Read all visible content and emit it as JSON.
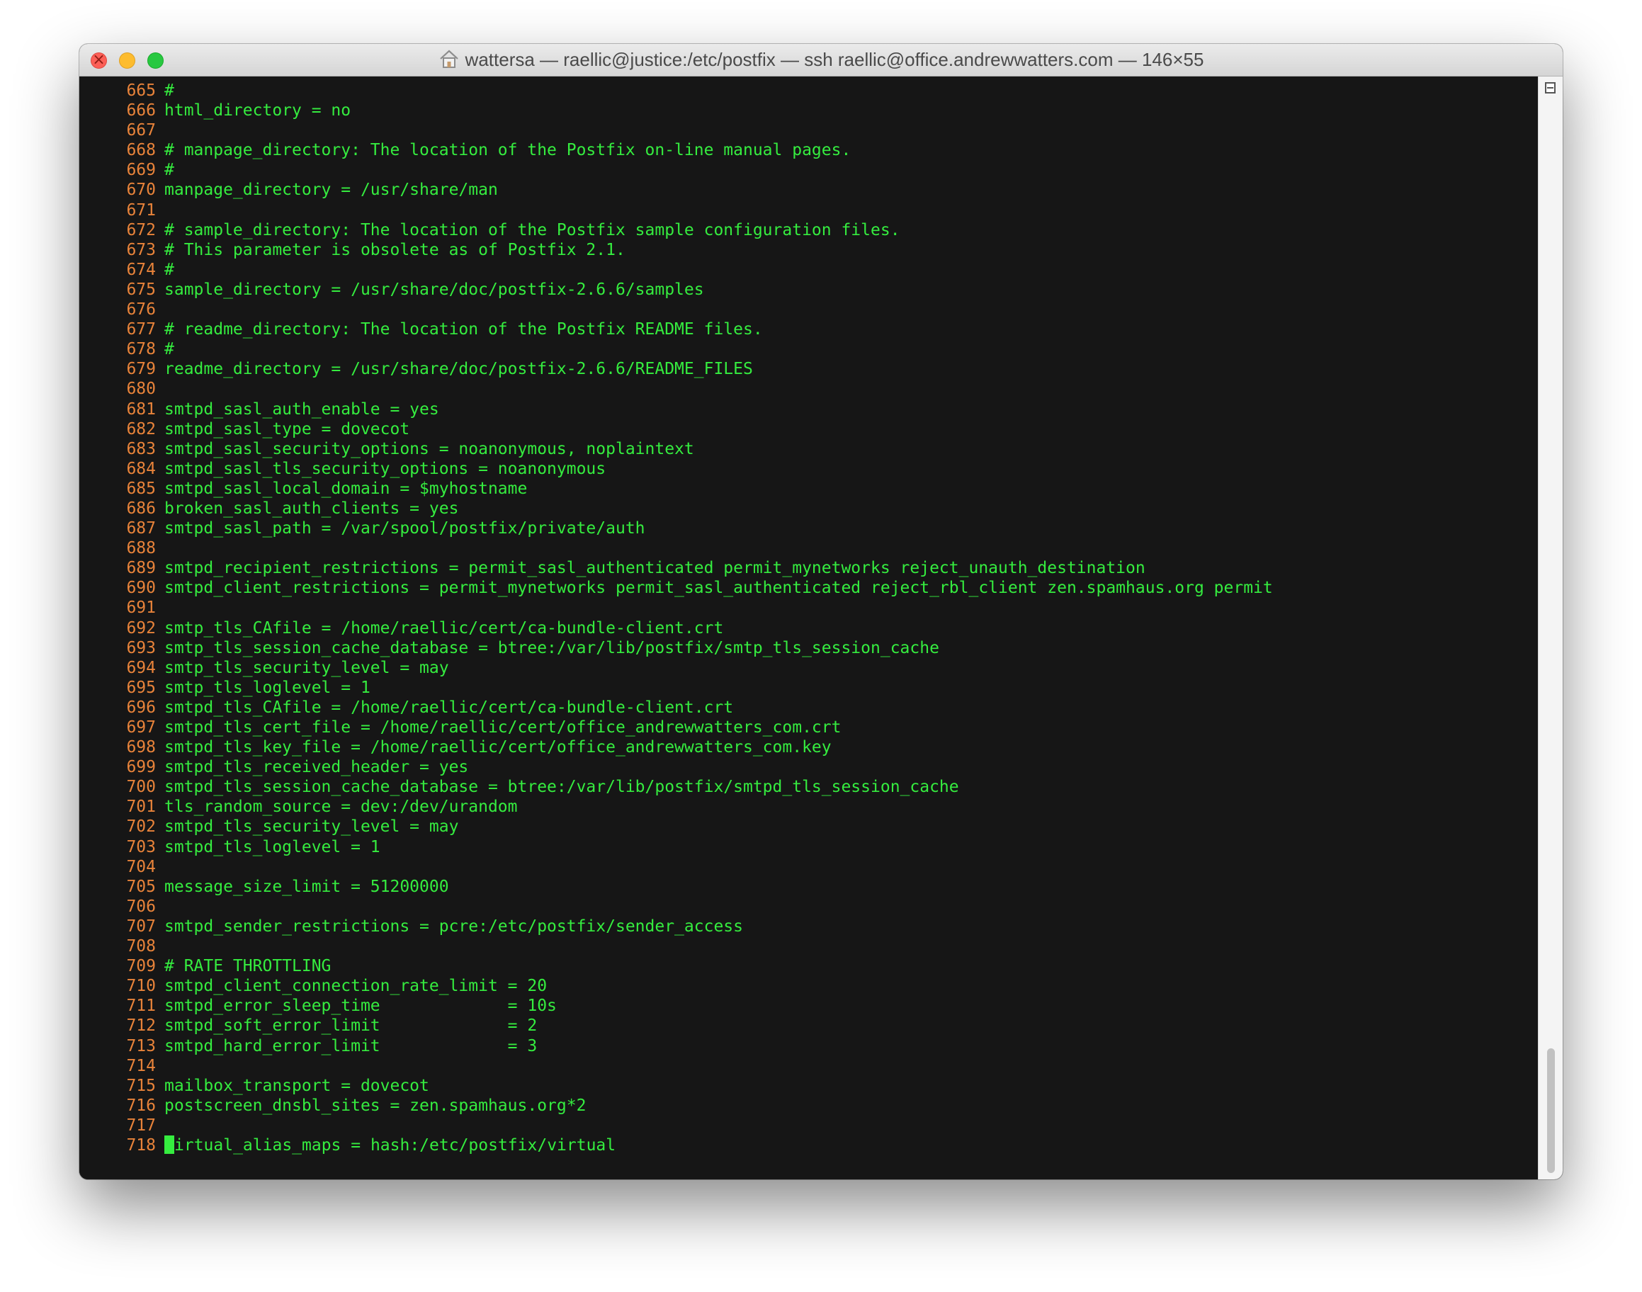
{
  "window": {
    "title": "wattersa — raellic@justice:/etc/postfix — ssh raellic@office.andrewwatters.com — 146×55"
  },
  "terminal": {
    "lines": [
      {
        "num": "665",
        "text": "#"
      },
      {
        "num": "666",
        "text": "html_directory = no"
      },
      {
        "num": "667",
        "text": ""
      },
      {
        "num": "668",
        "text": "# manpage_directory: The location of the Postfix on-line manual pages."
      },
      {
        "num": "669",
        "text": "#"
      },
      {
        "num": "670",
        "text": "manpage_directory = /usr/share/man"
      },
      {
        "num": "671",
        "text": ""
      },
      {
        "num": "672",
        "text": "# sample_directory: The location of the Postfix sample configuration files."
      },
      {
        "num": "673",
        "text": "# This parameter is obsolete as of Postfix 2.1."
      },
      {
        "num": "674",
        "text": "#"
      },
      {
        "num": "675",
        "text": "sample_directory = /usr/share/doc/postfix-2.6.6/samples"
      },
      {
        "num": "676",
        "text": ""
      },
      {
        "num": "677",
        "text": "# readme_directory: The location of the Postfix README files."
      },
      {
        "num": "678",
        "text": "#"
      },
      {
        "num": "679",
        "text": "readme_directory = /usr/share/doc/postfix-2.6.6/README_FILES"
      },
      {
        "num": "680",
        "text": ""
      },
      {
        "num": "681",
        "text": "smtpd_sasl_auth_enable = yes"
      },
      {
        "num": "682",
        "text": "smtpd_sasl_type = dovecot"
      },
      {
        "num": "683",
        "text": "smtpd_sasl_security_options = noanonymous, noplaintext"
      },
      {
        "num": "684",
        "text": "smtpd_sasl_tls_security_options = noanonymous"
      },
      {
        "num": "685",
        "text": "smtpd_sasl_local_domain = $myhostname"
      },
      {
        "num": "686",
        "text": "broken_sasl_auth_clients = yes"
      },
      {
        "num": "687",
        "text": "smtpd_sasl_path = /var/spool/postfix/private/auth"
      },
      {
        "num": "688",
        "text": ""
      },
      {
        "num": "689",
        "text": "smtpd_recipient_restrictions = permit_sasl_authenticated permit_mynetworks reject_unauth_destination"
      },
      {
        "num": "690",
        "text": "smtpd_client_restrictions = permit_mynetworks permit_sasl_authenticated reject_rbl_client zen.spamhaus.org permit"
      },
      {
        "num": "691",
        "text": ""
      },
      {
        "num": "692",
        "text": "smtp_tls_CAfile = /home/raellic/cert/ca-bundle-client.crt"
      },
      {
        "num": "693",
        "text": "smtp_tls_session_cache_database = btree:/var/lib/postfix/smtp_tls_session_cache"
      },
      {
        "num": "694",
        "text": "smtp_tls_security_level = may"
      },
      {
        "num": "695",
        "text": "smtp_tls_loglevel = 1"
      },
      {
        "num": "696",
        "text": "smtpd_tls_CAfile = /home/raellic/cert/ca-bundle-client.crt"
      },
      {
        "num": "697",
        "text": "smtpd_tls_cert_file = /home/raellic/cert/office_andrewwatters_com.crt"
      },
      {
        "num": "698",
        "text": "smtpd_tls_key_file = /home/raellic/cert/office_andrewwatters_com.key"
      },
      {
        "num": "699",
        "text": "smtpd_tls_received_header = yes"
      },
      {
        "num": "700",
        "text": "smtpd_tls_session_cache_database = btree:/var/lib/postfix/smtpd_tls_session_cache"
      },
      {
        "num": "701",
        "text": "tls_random_source = dev:/dev/urandom"
      },
      {
        "num": "702",
        "text": "smtpd_tls_security_level = may"
      },
      {
        "num": "703",
        "text": "smtpd_tls_loglevel = 1"
      },
      {
        "num": "704",
        "text": ""
      },
      {
        "num": "705",
        "text": "message_size_limit = 51200000"
      },
      {
        "num": "706",
        "text": ""
      },
      {
        "num": "707",
        "text": "smtpd_sender_restrictions = pcre:/etc/postfix/sender_access"
      },
      {
        "num": "708",
        "text": ""
      },
      {
        "num": "709",
        "text": "# RATE THROTTLING"
      },
      {
        "num": "710",
        "text": "smtpd_client_connection_rate_limit = 20"
      },
      {
        "num": "711",
        "text": "smtpd_error_sleep_time             = 10s"
      },
      {
        "num": "712",
        "text": "smtpd_soft_error_limit             = 2"
      },
      {
        "num": "713",
        "text": "smtpd_hard_error_limit             = 3"
      },
      {
        "num": "714",
        "text": ""
      },
      {
        "num": "715",
        "text": "mailbox_transport = dovecot"
      },
      {
        "num": "716",
        "text": "postscreen_dnsbl_sites = zen.spamhaus.org*2"
      },
      {
        "num": "717",
        "text": ""
      }
    ],
    "cursor_line": {
      "num": "718",
      "text": "irtual_alias_maps = hash:/etc/postfix/virtual"
    }
  },
  "colors": {
    "line_number": "#e8833a",
    "text": "#35ec3f",
    "background": "#161616"
  }
}
